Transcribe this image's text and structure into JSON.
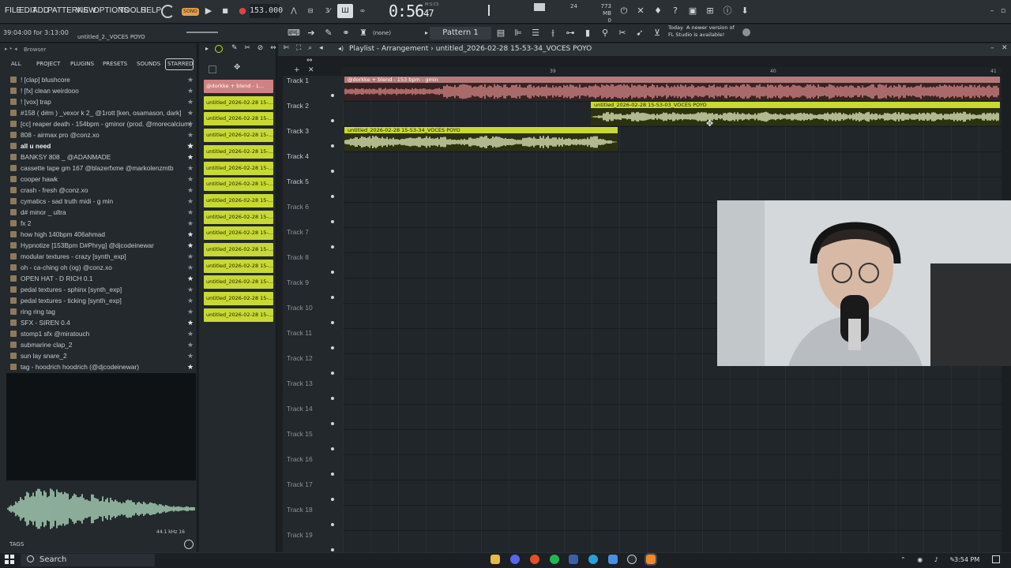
{
  "menu": [
    "FILE",
    "EDIT",
    "ADD",
    "PATTERNS",
    "VIEW",
    "OPTIONS",
    "TOOLS",
    "HELP"
  ],
  "transport": {
    "song_label": "SONG",
    "tempo": "153.000",
    "time": "0:56",
    "time_small": "47",
    "time_unit": "M:S:CS",
    "pattern_value": "24",
    "pattern_value2": "0",
    "memory": "773 MB",
    "memory2": "0"
  },
  "hint": {
    "time": "39:04:00 for 3:13:00",
    "file": "untitled_2._VOCES POYO"
  },
  "toolbar2": {
    "none_label": "(none)",
    "pattern": "Pattern 1",
    "update_today": "Today",
    "update_msg": "A newer version of FL Studio is available!"
  },
  "browser": {
    "title": "Browser",
    "tabs": [
      "ALL",
      "PROJECT",
      "PLUGINS",
      "PRESETS",
      "SOUNDS",
      "STARRED"
    ],
    "items": [
      {
        "label": "!  [clap] blushcore",
        "fav": false,
        "bold": false
      },
      {
        "label": "!  [fx] clean weirdooo",
        "fav": false,
        "bold": false
      },
      {
        "label": "!  [vox] trap",
        "fav": false,
        "bold": false
      },
      {
        "label": "#158 ( d#m ) _vexor k 2_ @1rott [ken, osamason, dark]",
        "fav": false,
        "bold": false
      },
      {
        "label": "[cc] reaper death - 154bpm - gminor (prod. @morecalcium)",
        "fav": false,
        "bold": false
      },
      {
        "label": "808 - airmax pro @conz.xo",
        "fav": false,
        "bold": false
      },
      {
        "label": "all u need",
        "fav": true,
        "bold": true
      },
      {
        "label": "BANKSY 808 _ @ADANMADE",
        "fav": true,
        "bold": false
      },
      {
        "label": "cassette tape gm 167 @blazerfxme @markolenzmtb",
        "fav": false,
        "bold": false
      },
      {
        "label": "cooper hawk",
        "fav": false,
        "bold": false
      },
      {
        "label": "crash - fresh @conz.xo",
        "fav": false,
        "bold": false
      },
      {
        "label": "cymatics - sad truth midi - g min",
        "fav": false,
        "bold": false
      },
      {
        "label": "d# minor _ ultra",
        "fav": false,
        "bold": false
      },
      {
        "label": "fx 2",
        "fav": false,
        "bold": false
      },
      {
        "label": "how high 140bpm 406ahmad",
        "fav": true,
        "bold": false
      },
      {
        "label": "Hypnotize [153Bpm D#Phryg] @djcodeinewar",
        "fav": true,
        "bold": false
      },
      {
        "label": "modular textures - crazy [synth_exp]",
        "fav": false,
        "bold": false
      },
      {
        "label": "oh - ca-ching oh (og) @conz.xo",
        "fav": false,
        "bold": false
      },
      {
        "label": "OPEN HAT - D RICH 0.1",
        "fav": true,
        "bold": false
      },
      {
        "label": "pedal textures - sphinx [synth_exp]",
        "fav": false,
        "bold": false
      },
      {
        "label": "pedal textures - ticking [synth_exp]",
        "fav": false,
        "bold": false
      },
      {
        "label": "ring ring tag",
        "fav": false,
        "bold": false
      },
      {
        "label": "SFX - SIREN 0.4",
        "fav": true,
        "bold": false
      },
      {
        "label": "stomp1 sfx @miratouch",
        "fav": false,
        "bold": false
      },
      {
        "label": "submarine clap_2",
        "fav": false,
        "bold": false
      },
      {
        "label": "sun lay snare_2",
        "fav": false,
        "bold": false
      },
      {
        "label": "tag - hoodrich hoodrich (@djcodeinewar)",
        "fav": true,
        "bold": false
      }
    ],
    "wave_info": "44.1 kHz 16",
    "tags_label": "TAGS"
  },
  "picker": {
    "clips": [
      "@dorkke + blend - 1...",
      "untitled_2026-02-28 15-...",
      "untitled_2026-02-28 15-...",
      "untitled_2026-02-28 15-...",
      "untitled_2026-02-28 15-...",
      "untitled_2026-02-28 15-...",
      "untitled_2026-02-28 15-...",
      "untitled_2026-02-28 15-...",
      "untitled_2026-02-28 15-...",
      "untitled_2026-02-28 15-...",
      "untitled_2026-02-28 15-...",
      "untitled_2026-02-28 15-...",
      "untitled_2026-02-28 15-...",
      "untitled_2026-02-28 15-...",
      "untitled_2026-02-28 15-..."
    ]
  },
  "playlist": {
    "title": "Playlist - Arrangement",
    "sep": "›",
    "file": "untitled_2026-02-28 15-53-34_VOCES POYO",
    "ruler": [
      "39",
      "40",
      "41"
    ],
    "tracks": [
      "Track 1",
      "Track 2",
      "Track 3",
      "Track 4",
      "Track 5",
      "Track 6",
      "Track 7",
      "Track 8",
      "Track 9",
      "Track 10",
      "Track 11",
      "Track 12",
      "Track 13",
      "Track 14",
      "Track 15",
      "Track 16",
      "Track 17",
      "Track 18",
      "Track 19"
    ],
    "clip1_label": "@dorkke + blend - 153 bpm - gmin",
    "clip2_label": "untitled_2026-02-28 15-53-03_VOCES POYO",
    "clip3_label": "untitled_2026-02-28 15-53-34_VOCES POYO"
  },
  "taskbar": {
    "search": "Search",
    "clock": "3:54 PM"
  }
}
